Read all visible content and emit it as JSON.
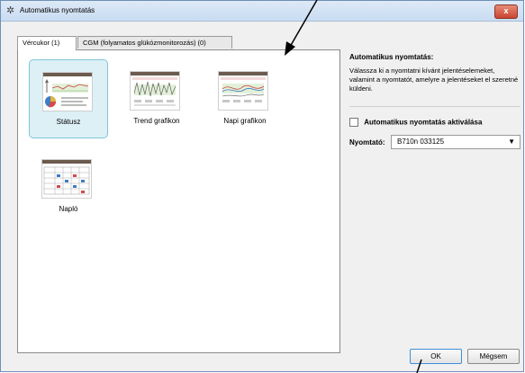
{
  "window": {
    "title": "Automatikus nyomtatás",
    "close_label": "x"
  },
  "tabs": [
    {
      "label": "Vércukor (1)",
      "active": true
    },
    {
      "label": "CGM (folyamatos glükózmonitorozás) (0)",
      "active": false
    }
  ],
  "reports": [
    {
      "label": "Státusz",
      "icon": "status-report-icon",
      "selected": true
    },
    {
      "label": "Trend grafikon",
      "icon": "trend-chart-icon",
      "selected": false
    },
    {
      "label": "Napi grafikon",
      "icon": "daily-chart-icon",
      "selected": false
    },
    {
      "label": "Napló",
      "icon": "logbook-icon",
      "selected": false
    }
  ],
  "side": {
    "heading": "Automatikus nyomtatás:",
    "description": "Válassza ki a nyomtatni kívánt jelentéselemeket, valamint a nyomtatót, amelyre a jelentéseket el szeretné küldeni.",
    "enable_label": "Automatikus nyomtatás aktiválása",
    "enable_checked": false,
    "printer_label": "Nyomtató:",
    "printer_value": "B710n 033125"
  },
  "buttons": {
    "ok": "OK",
    "cancel": "Mégsem"
  },
  "colors": {
    "accent": "#3c8fd8",
    "selected_bg": "#dcf0f6",
    "thumb_header": "#6c5b4f",
    "close": "#c8452f"
  }
}
